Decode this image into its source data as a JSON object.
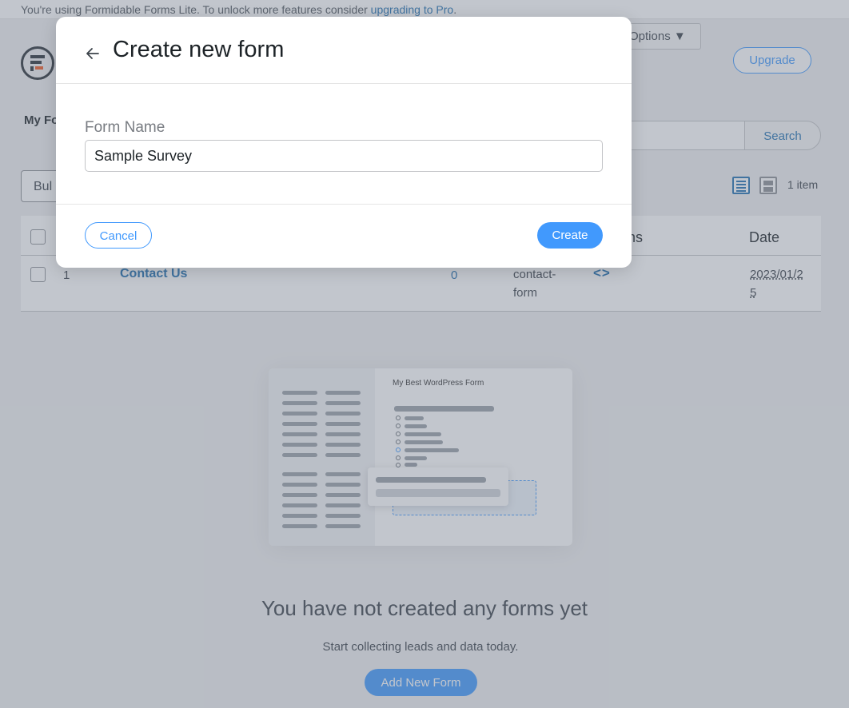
{
  "notice": {
    "text": "You're using Formidable Forms Lite. To unlock more features consider ",
    "link": "upgrading to Pro",
    "suffix": "."
  },
  "header": {
    "options_label": "Options ▼",
    "upgrade_label": "Upgrade"
  },
  "tabs": {
    "my_forms": "My Fo"
  },
  "search": {
    "button_label": "Search",
    "placeholder": ""
  },
  "bulk": {
    "label": "Bul"
  },
  "view": {
    "item_count": "1 item"
  },
  "table": {
    "headers": {
      "shortcodes": "ns",
      "date": "Date"
    },
    "rows": [
      {
        "id": "1",
        "name": "Contact Us",
        "entries": "0",
        "key_line1": "contact-",
        "key_line2": "form",
        "date_line1": "2023/01/2",
        "date_line2": "5"
      }
    ]
  },
  "illustration": {
    "title": "My Best WordPress Form"
  },
  "empty_state": {
    "title": "You have not created any forms yet",
    "subtitle": "Start collecting leads and data today.",
    "button_label": "Add New Form"
  },
  "modal": {
    "title": "Create new form",
    "field_label": "Form Name",
    "field_value": "Sample Survey",
    "cancel_label": "Cancel",
    "create_label": "Create"
  },
  "colors": {
    "accent": "#4199fd",
    "link": "#2271b1",
    "brand_orange": "#f05a24"
  }
}
